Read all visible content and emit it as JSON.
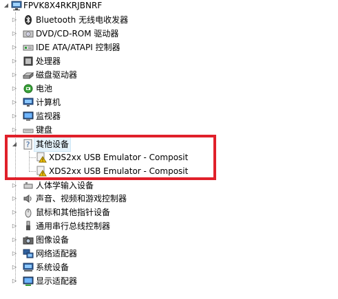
{
  "root": {
    "label": "FPVK8X4RKRJBNRF",
    "icon": "computer-root-icon"
  },
  "categories": [
    {
      "label": "Bluetooth 无线电收发器",
      "icon": "bluetooth-icon",
      "expanded": false
    },
    {
      "label": "DVD/CD-ROM 驱动器",
      "icon": "optical-drive-icon",
      "expanded": false
    },
    {
      "label": "IDE ATA/ATAPI 控制器",
      "icon": "ide-controller-icon",
      "expanded": false
    },
    {
      "label": "处理器",
      "icon": "processor-icon",
      "expanded": false
    },
    {
      "label": "磁盘驱动器",
      "icon": "disk-drive-icon",
      "expanded": false
    },
    {
      "label": "电池",
      "icon": "battery-icon",
      "expanded": false
    },
    {
      "label": "计算机",
      "icon": "computer-icon",
      "expanded": false
    },
    {
      "label": "监视器",
      "icon": "monitor-icon",
      "expanded": false
    },
    {
      "label": "键盘",
      "icon": "keyboard-icon",
      "expanded": false
    },
    {
      "label": "其他设备",
      "icon": "unknown-device-icon",
      "expanded": true,
      "selected": true
    },
    {
      "label": "人体学输入设备",
      "icon": "hid-icon",
      "expanded": false
    },
    {
      "label": "声音、视频和游戏控制器",
      "icon": "sound-icon",
      "expanded": false
    },
    {
      "label": "鼠标和其他指针设备",
      "icon": "mouse-icon",
      "expanded": false
    },
    {
      "label": "通用串行总线控制器",
      "icon": "usb-icon",
      "expanded": false
    },
    {
      "label": "图像设备",
      "icon": "camera-icon",
      "expanded": false
    },
    {
      "label": "网络适配器",
      "icon": "network-icon",
      "expanded": false
    },
    {
      "label": "系统设备",
      "icon": "system-device-icon",
      "expanded": false
    },
    {
      "label": "显示适配器",
      "icon": "display-adapter-icon",
      "expanded": false
    }
  ],
  "other_devices": [
    {
      "label": "XDS2xx USB Emulator - Composit",
      "icon": "warning-device-icon"
    },
    {
      "label": "XDS2xx USB Emulator - Composit",
      "icon": "warning-device-icon"
    }
  ],
  "colors": {
    "highlight_border": "#e0202a",
    "selection": "#e5f3fb",
    "warning": "#f5c400"
  }
}
